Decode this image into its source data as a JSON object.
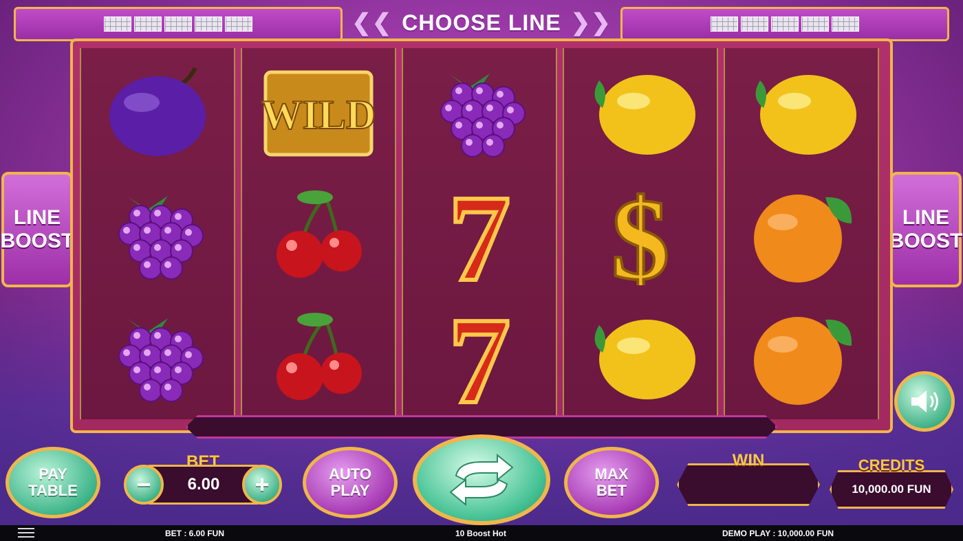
{
  "top": {
    "choose_line": "CHOOSE LINE",
    "left_arrow": "❮❮",
    "right_arrow": "❯❯",
    "left_line_count": 5,
    "right_line_count": 5
  },
  "side": {
    "line_boost_1": "LINE",
    "line_boost_2": "BOOST"
  },
  "reels": [
    [
      "plum",
      "grapes",
      "grapes"
    ],
    [
      "wild",
      "cherry",
      "cherry"
    ],
    [
      "grapes",
      "seven",
      "seven"
    ],
    [
      "lemon",
      "dollar",
      "lemon"
    ],
    [
      "lemon",
      "orange",
      "orange"
    ]
  ],
  "wild_label": "WILD",
  "controls": {
    "pay_table_1": "PAY",
    "pay_table_2": "TABLE",
    "bet_label": "BET",
    "bet_value": "6.00",
    "minus": "−",
    "plus": "+",
    "auto_play_1": "AUTO",
    "auto_play_2": "PLAY",
    "max_bet_1": "MAX",
    "max_bet_2": "BET",
    "win_label": "WIN",
    "credits_label": "CREDITS",
    "credits_value": "10,000.00 FUN"
  },
  "footer": {
    "bet": "BET : 6.00 FUN",
    "game_title": "10 Boost Hot",
    "demo": "DEMO PLAY : 10,000.00 FUN"
  },
  "colors": {
    "gold": "#f0b64a",
    "purple": "#9c3aa8",
    "green": "#44b48b"
  }
}
